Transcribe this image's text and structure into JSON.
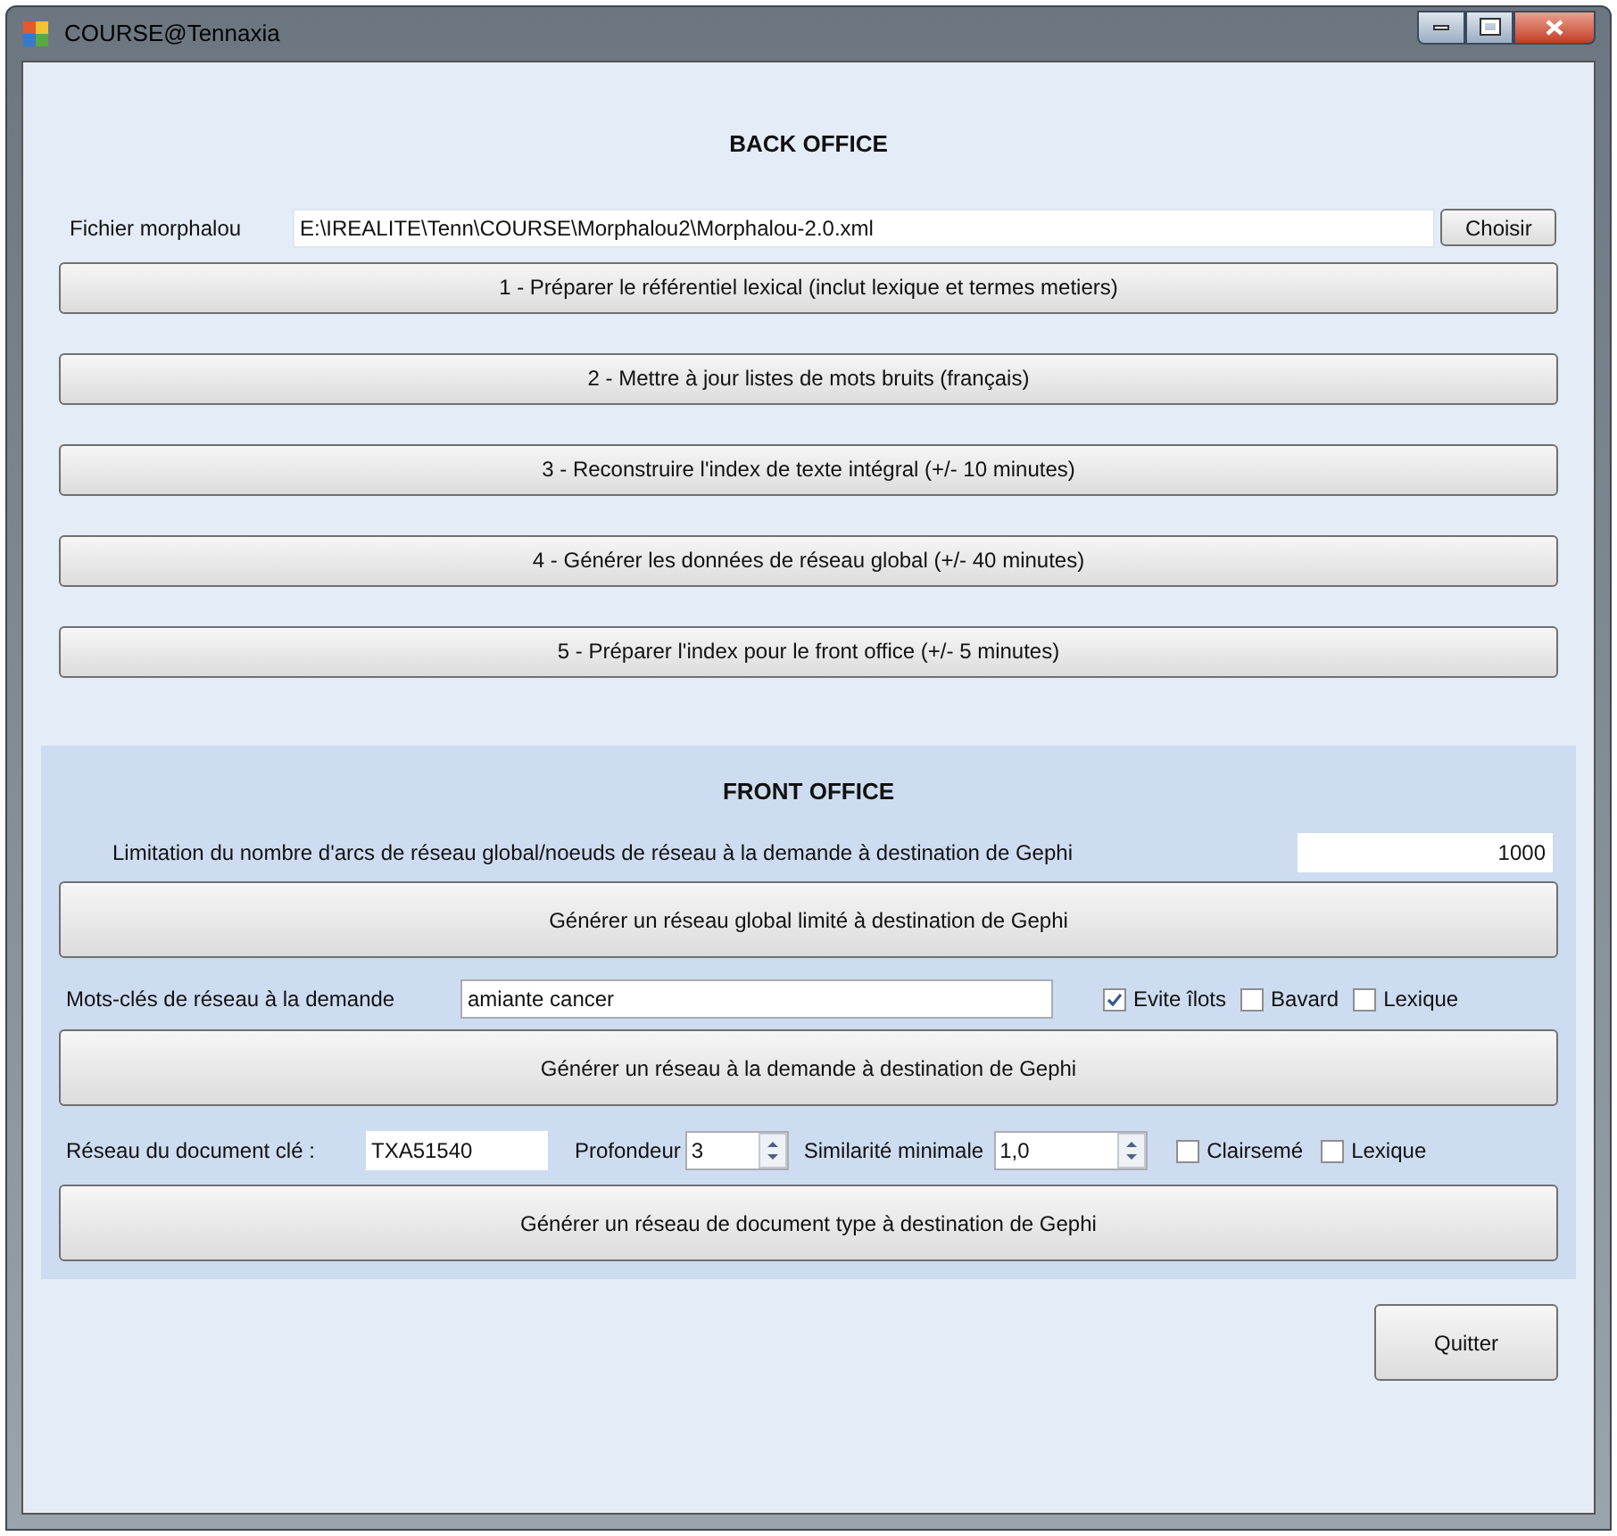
{
  "window": {
    "title": "COURSE@Tennaxia"
  },
  "back_office": {
    "title": "BACK OFFICE",
    "file_label": "Fichier morphalou",
    "file_value": "E:\\IREALITE\\Tenn\\COURSE\\Morphalou2\\Morphalou-2.0.xml",
    "browse_button": "Choisir",
    "steps": [
      "1 - Préparer le référentiel lexical (inclut lexique et termes metiers)",
      "2 - Mettre à jour listes de mots bruits (français)",
      "3 - Reconstruire l'index de texte intégral (+/- 10 minutes)",
      "4 - Générer les données de réseau global (+/- 40 minutes)",
      "5 - Préparer l'index pour le front office (+/- 5 minutes)"
    ]
  },
  "front_office": {
    "title": "FRONT OFFICE",
    "limit_label": "Limitation du nombre d'arcs de réseau global/noeuds de réseau à la demande à destination de Gephi",
    "limit_value": "1000",
    "global_button": "Générer un réseau global limité à destination de Gephi",
    "keywords_label": "Mots-clés de réseau à la demande",
    "keywords_value": "amiante cancer",
    "keyword_options": [
      {
        "label": "Evite îlots",
        "checked": true
      },
      {
        "label": "Bavard",
        "checked": false
      },
      {
        "label": "Lexique",
        "checked": false
      }
    ],
    "demand_button": "Générer un réseau à la demande à destination de Gephi",
    "document_label": "Réseau du document clé :",
    "document_value": "TXA51540",
    "depth_label": "Profondeur",
    "depth_value": "3",
    "similarity_label": "Similarité minimale",
    "similarity_value": "1,0",
    "document_options": [
      {
        "label": "Clairsemé",
        "checked": false
      },
      {
        "label": "Lexique",
        "checked": false
      }
    ],
    "document_button": "Générer un réseau de document type à destination de Gephi"
  },
  "quit_button": "Quitter"
}
